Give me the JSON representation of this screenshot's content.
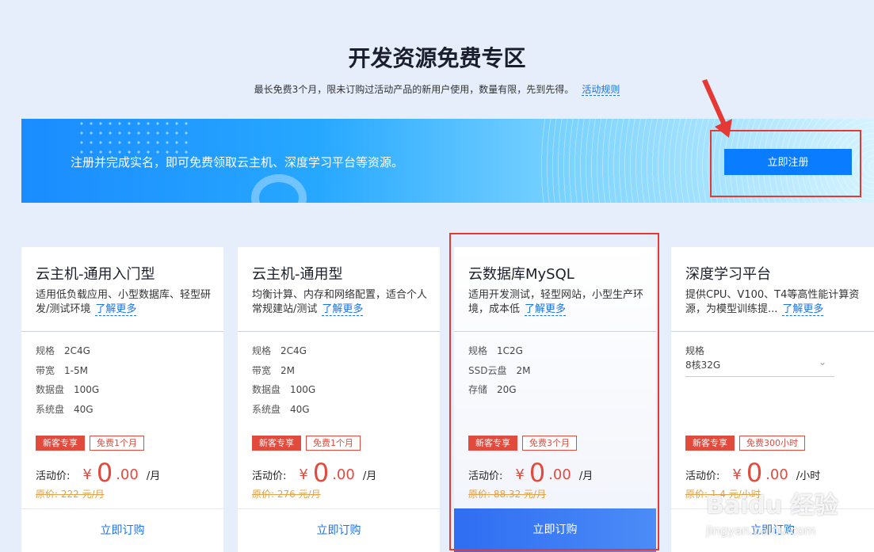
{
  "header": {
    "title": "开发资源免费专区",
    "subtitle": "最长免费3个月，限未订购过活动产品的新用户使用，数量有限，先到先得。",
    "rules_link": "活动规则"
  },
  "banner": {
    "text": "注册并完成实名，即可免费领取云主机、深度学习平台等资源。",
    "register_button": "立即注册"
  },
  "cards": [
    {
      "title": "云主机-通用入门型",
      "desc": "适用低负载应用、小型数据库、轻型研发/测试环境",
      "more": "了解更多",
      "specs": [
        {
          "k": "规格",
          "v": "2C4G"
        },
        {
          "k": "带宽",
          "v": "1-5M"
        },
        {
          "k": "数据盘",
          "v": "100G"
        },
        {
          "k": "系统盘",
          "v": "40G"
        }
      ],
      "tag1": "新客专享",
      "tag2": "免费1个月",
      "price_label": "活动价:",
      "currency": "¥",
      "price_int": "0",
      "price_dec": ".00",
      "unit": "/月",
      "orig": "原价: 222 元/月",
      "order": "立即订购"
    },
    {
      "title": "云主机-通用型",
      "desc": "均衡计算、内存和网络配置，适合个人常规建站/测试",
      "more": "了解更多",
      "specs": [
        {
          "k": "规格",
          "v": "2C4G"
        },
        {
          "k": "带宽",
          "v": "2M"
        },
        {
          "k": "数据盘",
          "v": "100G"
        },
        {
          "k": "系统盘",
          "v": "40G"
        }
      ],
      "tag1": "新客专享",
      "tag2": "免费1个月",
      "price_label": "活动价:",
      "currency": "¥",
      "price_int": "0",
      "price_dec": ".00",
      "unit": "/月",
      "orig": "原价: 276 元/月",
      "order": "立即订购"
    },
    {
      "title": "云数据库MySQL",
      "desc": "适用开发测试，轻型网站，小型生产环境，成本低",
      "more": "了解更多",
      "specs": [
        {
          "k": "规格",
          "v": "1C2G"
        },
        {
          "k": "SSD云盘",
          "v": "2M"
        },
        {
          "k": "存储",
          "v": "20G"
        }
      ],
      "tag1": "新客专享",
      "tag2": "免费3个月",
      "price_label": "活动价:",
      "currency": "¥",
      "price_int": "0",
      "price_dec": ".00",
      "unit": "/月",
      "orig": "原价: 88.32 元/月",
      "order": "立即订购"
    },
    {
      "title": "深度学习平台",
      "desc": "提供CPU、V100、T4等高性能计算资源，为模型训练提...",
      "more": "了解更多",
      "spec_label": "规格",
      "select_value": "8核32G",
      "tag1": "新客专享",
      "tag2": "免费300小时",
      "price_label": "活动价:",
      "currency": "¥",
      "price_int": "0",
      "price_dec": ".00",
      "unit": "/小时",
      "orig": "原价: 1.4 元/小时",
      "order": "立即订购"
    }
  ],
  "watermark": {
    "brand": "Baidu 经验",
    "url": "jingyan.baidu.com"
  },
  "colors": {
    "accent": "#1a73e8",
    "price": "#e04b3e",
    "annotation": "#e53935"
  }
}
